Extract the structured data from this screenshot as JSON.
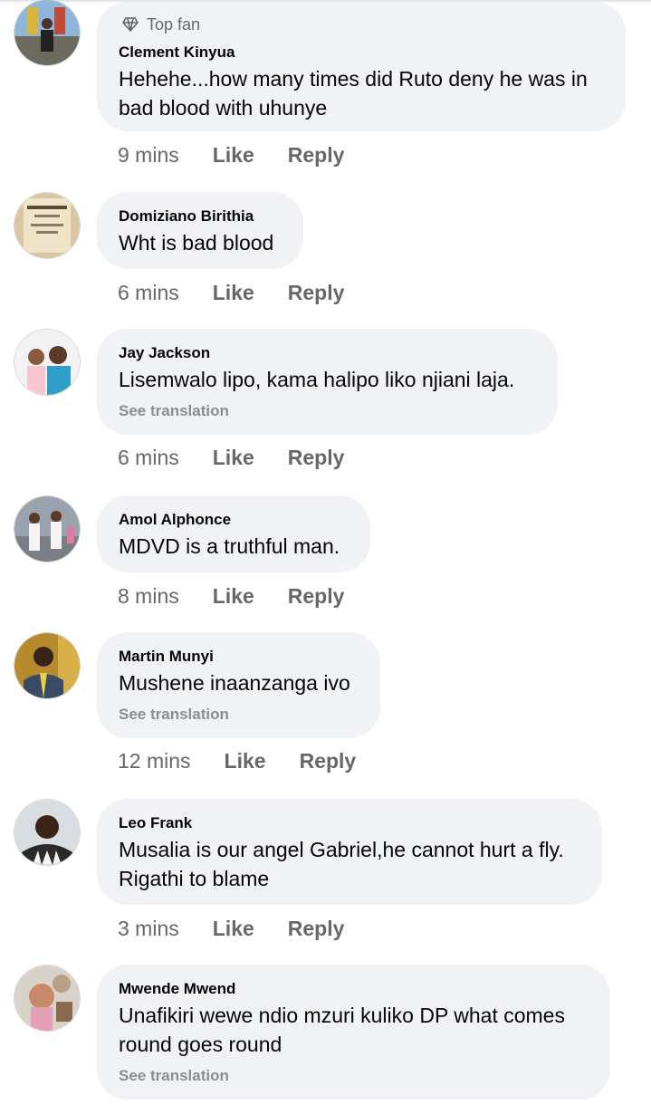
{
  "comments": [
    {
      "badge": "Top fan",
      "author": "Clement Kinyua",
      "lines": [
        "Hehehe...how many times did Ruto deny he was in",
        "bad blood with uhunye"
      ],
      "translation": "",
      "time": "9 mins",
      "like": "Like",
      "reply": "Reply"
    },
    {
      "badge": "",
      "author": "Domiziano Birithia",
      "lines": [
        "Wht is bad blood"
      ],
      "translation": "",
      "time": "6 mins",
      "like": "Like",
      "reply": "Reply"
    },
    {
      "badge": "",
      "author": "Jay Jackson",
      "lines": [
        "Lisemwalo lipo, kama halipo liko njiani laja."
      ],
      "translation": "See translation",
      "time": "6 mins",
      "like": "Like",
      "reply": "Reply"
    },
    {
      "badge": "",
      "author": "Amol Alphonce",
      "lines": [
        "MDVD is a truthful man."
      ],
      "translation": "",
      "time": "8 mins",
      "like": "Like",
      "reply": "Reply"
    },
    {
      "badge": "",
      "author": "Martin Munyi",
      "lines": [
        "Mushene inaanzanga ivo"
      ],
      "translation": "See translation",
      "time": "12 mins",
      "like": "Like",
      "reply": "Reply"
    },
    {
      "badge": "",
      "author": "Leo Frank",
      "lines": [
        "Musalia is our angel Gabriel,he cannot hurt a fly.",
        "Rigathi to blame"
      ],
      "translation": "",
      "time": "3 mins",
      "like": "Like",
      "reply": "Reply"
    },
    {
      "badge": "",
      "author": "Mwende Mwend",
      "lines": [
        "Unafikiri wewe ndio mzuri kuliko DP what comes",
        "round goes round"
      ],
      "translation": "See translation",
      "time": "",
      "like": "",
      "reply": ""
    }
  ]
}
